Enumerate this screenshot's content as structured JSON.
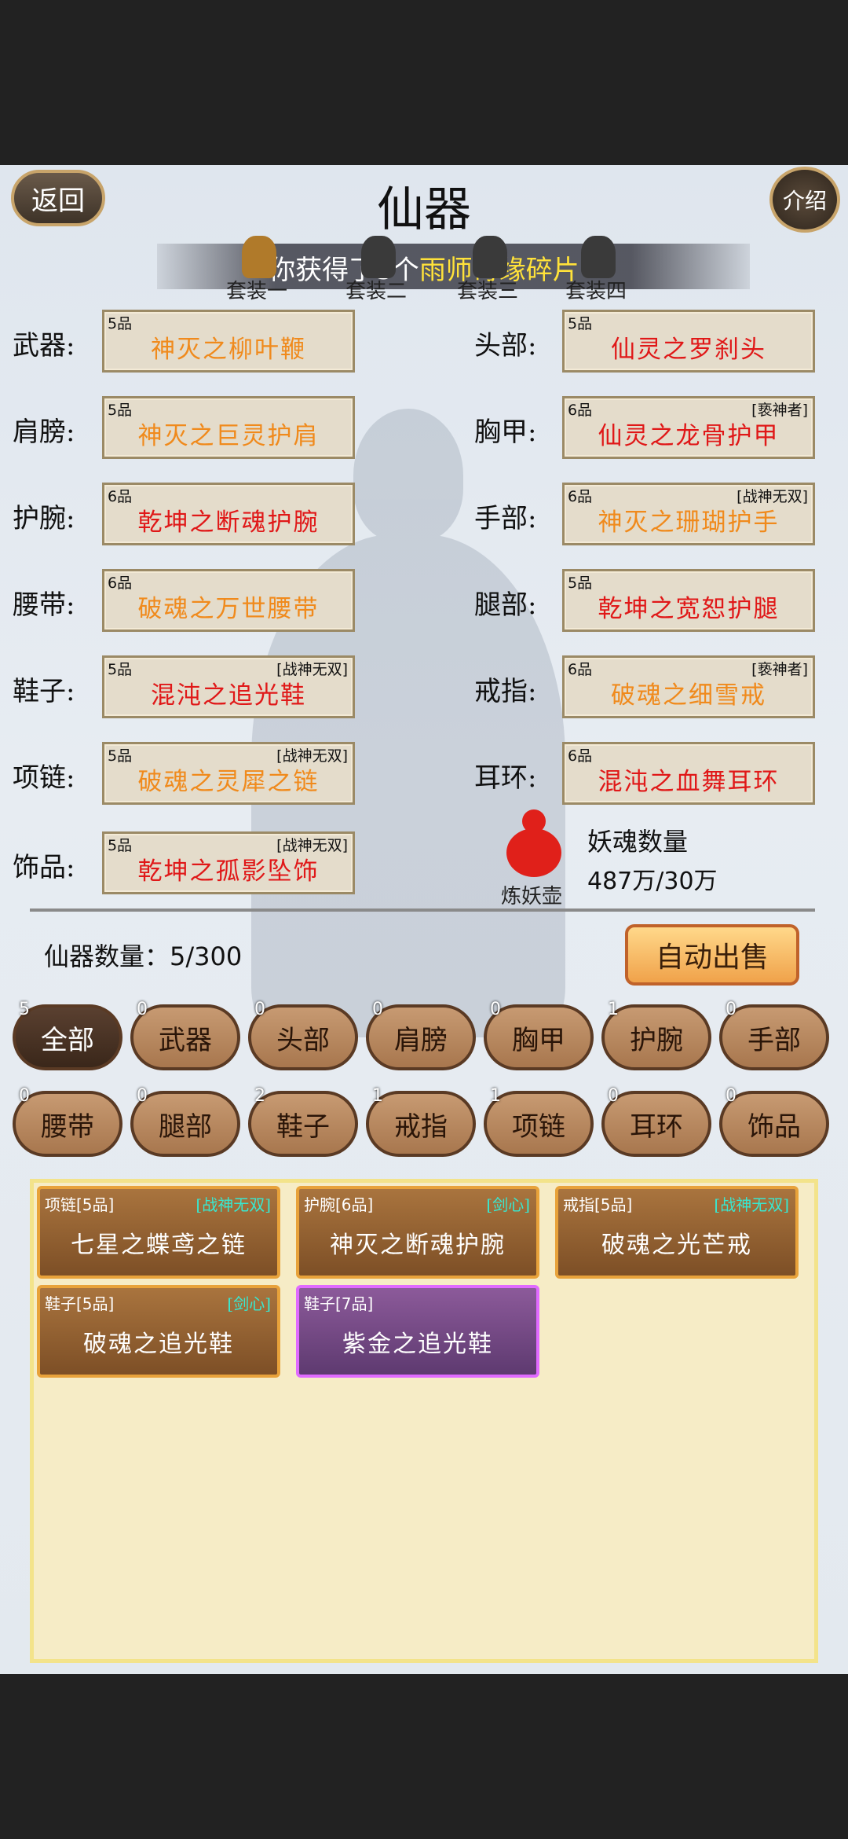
{
  "header": {
    "back_label": "返回",
    "title": "仙器",
    "intro_label": "介绍"
  },
  "banner": {
    "prefix": "你获得了5个",
    "highlight": "雨师奇缘碎片"
  },
  "sets": [
    "套装一",
    "套装二",
    "套装三",
    "套装四"
  ],
  "slots": [
    {
      "label": "武器:",
      "grade": "5品",
      "tag": "",
      "name": "神灭之柳叶鞭",
      "color": "orange"
    },
    {
      "label": "头部:",
      "grade": "5品",
      "tag": "",
      "name": "仙灵之罗刹头",
      "color": "red"
    },
    {
      "label": "肩膀:",
      "grade": "5品",
      "tag": "",
      "name": "神灭之巨灵护肩",
      "color": "orange"
    },
    {
      "label": "胸甲:",
      "grade": "6品",
      "tag": "[亵神者]",
      "name": "仙灵之龙骨护甲",
      "color": "red"
    },
    {
      "label": "护腕:",
      "grade": "6品",
      "tag": "",
      "name": "乾坤之断魂护腕",
      "color": "red"
    },
    {
      "label": "手部:",
      "grade": "6品",
      "tag": "[战神无双]",
      "name": "神灭之珊瑚护手",
      "color": "orange"
    },
    {
      "label": "腰带:",
      "grade": "6品",
      "tag": "",
      "name": "破魂之万世腰带",
      "color": "orange"
    },
    {
      "label": "腿部:",
      "grade": "5品",
      "tag": "",
      "name": "乾坤之宽恕护腿",
      "color": "red"
    },
    {
      "label": "鞋子:",
      "grade": "5品",
      "tag": "[战神无双]",
      "name": "混沌之追光鞋",
      "color": "red"
    },
    {
      "label": "戒指:",
      "grade": "6品",
      "tag": "[亵神者]",
      "name": "破魂之细雪戒",
      "color": "orange"
    },
    {
      "label": "项链:",
      "grade": "5品",
      "tag": "[战神无双]",
      "name": "破魂之灵犀之链",
      "color": "orange"
    },
    {
      "label": "耳环:",
      "grade": "6品",
      "tag": "",
      "name": "混沌之血舞耳环",
      "color": "red"
    },
    {
      "label": "饰品:",
      "grade": "5品",
      "tag": "[战神无双]",
      "name": "乾坤之孤影坠饰",
      "color": "red"
    }
  ],
  "gourd": {
    "label": "炼妖壶",
    "icon": "gourd-icon",
    "soul_title": "妖魂数量",
    "soul_value": "487万/30万"
  },
  "inventory_count": {
    "label": "仙器数量：",
    "value": "5/300"
  },
  "auto_sell_label": "自动出售",
  "tabs": [
    {
      "label": "全部",
      "badge": "5"
    },
    {
      "label": "武器",
      "badge": "0"
    },
    {
      "label": "头部",
      "badge": "0"
    },
    {
      "label": "肩膀",
      "badge": "0"
    },
    {
      "label": "胸甲",
      "badge": "0"
    },
    {
      "label": "护腕",
      "badge": "1"
    },
    {
      "label": "手部",
      "badge": "0"
    },
    {
      "label": "腰带",
      "badge": "0"
    },
    {
      "label": "腿部",
      "badge": "0"
    },
    {
      "label": "鞋子",
      "badge": "2"
    },
    {
      "label": "戒指",
      "badge": "1"
    },
    {
      "label": "项链",
      "badge": "1"
    },
    {
      "label": "耳环",
      "badge": "0"
    },
    {
      "label": "饰品",
      "badge": "0"
    }
  ],
  "items": [
    {
      "cat": "项链[5品]",
      "tag": "[战神无双]",
      "name": "七星之蝶鸢之链",
      "rarity": "gold"
    },
    {
      "cat": "护腕[6品]",
      "tag": "[剑心]",
      "name": "神灭之断魂护腕",
      "rarity": "gold"
    },
    {
      "cat": "戒指[5品]",
      "tag": "[战神无双]",
      "name": "破魂之光芒戒",
      "rarity": "gold"
    },
    {
      "cat": "鞋子[5品]",
      "tag": "[剑心]",
      "name": "破魂之追光鞋",
      "rarity": "gold"
    },
    {
      "cat": "鞋子[7品]",
      "tag": "",
      "name": "紫金之追光鞋",
      "rarity": "purple"
    }
  ],
  "colors": {
    "orange": "#f08a1c",
    "red": "#e01818",
    "tag_cyan": "#38e8d0"
  }
}
